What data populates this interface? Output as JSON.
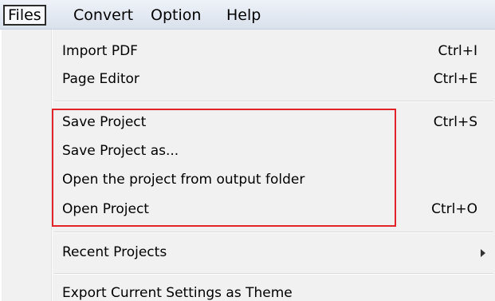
{
  "menubar": {
    "items": [
      {
        "label": "Files"
      },
      {
        "label": "Convert"
      },
      {
        "label": "Option"
      },
      {
        "label": "Help"
      }
    ]
  },
  "dropdown": {
    "items": [
      {
        "label": "Import PDF",
        "shortcut": "Ctrl+I"
      },
      {
        "label": "Page Editor",
        "shortcut": "Ctrl+E"
      },
      {
        "label": "Save Project",
        "shortcut": "Ctrl+S"
      },
      {
        "label": "Save Project as...",
        "shortcut": ""
      },
      {
        "label": "Open the project from output folder",
        "shortcut": ""
      },
      {
        "label": "Open Project",
        "shortcut": "Ctrl+O"
      },
      {
        "label": "Recent Projects",
        "shortcut": "",
        "submenu_icon": "chevron-right-icon"
      },
      {
        "label": "Export Current Settings as Theme",
        "shortcut": ""
      }
    ]
  },
  "colors": {
    "highlight_border": "#e0242a",
    "menu_background": "#f1f1f1",
    "menubar_background": "#e3e9f2"
  }
}
